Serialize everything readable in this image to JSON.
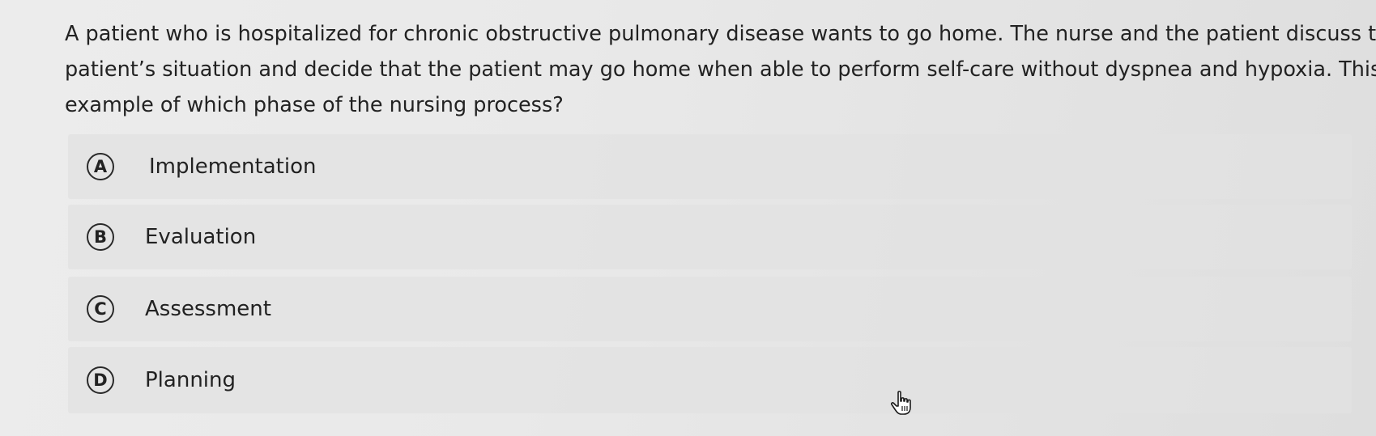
{
  "question": {
    "lines": [
      "A patient who is hospitalized for chronic obstructive pulmonary disease wants to go home. The nurse and the patient discuss the",
      "patient’s situation and decide that the patient may go home when able to perform self-care without dyspnea and hypoxia. This is an",
      "example of which phase of the nursing process?"
    ]
  },
  "options": [
    {
      "letter": "A",
      "label": "Implementation"
    },
    {
      "letter": "B",
      "label": "Evaluation"
    },
    {
      "letter": "C",
      "label": "Assessment"
    },
    {
      "letter": "D",
      "label": "Planning"
    }
  ],
  "cursor": {
    "icon": "hand-pointer-icon"
  }
}
